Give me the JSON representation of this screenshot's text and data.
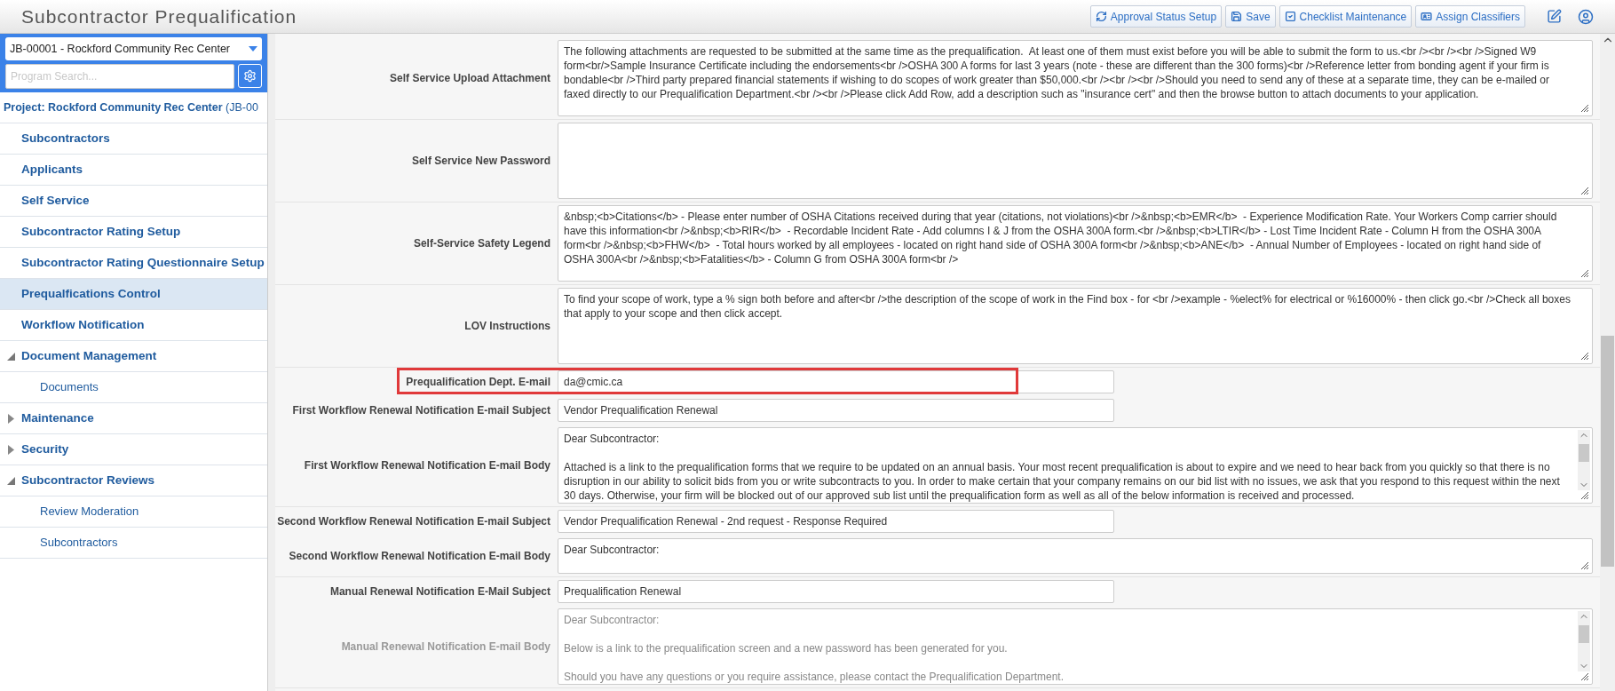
{
  "header": {
    "title": "Subcontractor Prequalification",
    "buttons": [
      {
        "kind": "refresh",
        "label": "Approval Status Setup"
      },
      {
        "kind": "save",
        "label": "Save"
      },
      {
        "kind": "check",
        "label": "Checklist Maintenance"
      },
      {
        "kind": "card",
        "label": "Assign Classifiers"
      }
    ]
  },
  "sidebar": {
    "project_select": "JB-00001 - Rockford Community Rec Center",
    "search": {
      "placeholder": "Program Search..."
    },
    "project": "**Project: Rockford Community Rec Center** (JB-00",
    "items": [
      {
        "label": "Subcontractors",
        "selected": false
      },
      {
        "label": "Applicants",
        "selected": false
      },
      {
        "label": "Self Service",
        "selected": false
      },
      {
        "label": "Subcontractor Rating Setup",
        "selected": false
      },
      {
        "label": "Subcontractor Rating Questionnaire Setup",
        "selected": false
      },
      {
        "label": "Prequalfications Control",
        "selected": true
      },
      {
        "label": "Workflow Notification",
        "selected": false
      },
      {
        "label": "Document Management",
        "selected": false,
        "expanded": true,
        "children": [
          {
            "label": "Documents",
            "selected": false
          }
        ]
      },
      {
        "label": "Maintenance",
        "selected": false,
        "expanded": false
      },
      {
        "label": "Security",
        "selected": false,
        "expanded": false
      },
      {
        "label": "Subcontractor Reviews",
        "selected": false,
        "expanded": true,
        "children": [
          {
            "label": "Review Moderation",
            "selected": false
          },
          {
            "label": "Subcontractors",
            "selected": false
          }
        ]
      }
    ]
  },
  "form": {
    "fields": [
      {
        "kind": "textarea",
        "label": "Self Service Upload Attachment",
        "value": "The following attachments are requested to be submitted at the same time as the prequalification.  At least one of them must exist before you will be able to submit the form to us.<br /><br /><br />Signed W9 form<br/>Sample Insurance Certificate including the endorsements<br />OSHA 300 A forms for last 3 years (note - these are different than the 300 forms)<br />Reference letter from bonding agent if your firm is bondable<br />Third party prepared financial statements if wishing to do scopes of work greater than $50,000.<br /><br /><br />Should you need to send any of these at a separate time, they can be e-mailed or faxed directly to our Prequalification Department.<br /><br />Please click Add Row, add a description such as \"insurance cert\" and then the browse button to attach documents to your application."
      },
      {
        "kind": "textarea",
        "label": "Self Service New Password"
      },
      {
        "kind": "textarea",
        "label": "Self-Service Safety Legend",
        "value": "&nbsp;<b>Citations</b> - Please enter number of OSHA Citations received during that year (citations, not violations)<br />&nbsp;<b>EMR</b>  - Experience Modification Rate. Your Workers Comp carrier should have this information<br />&nbsp;<b>RIR</b>  - Recordable Incident Rate - Add columns I & J from the OSHA 300A form.<br />&nbsp;<b>LTIR</b> - Lost Time Incident Rate - Column H from the OSHA 300A form<br />&nbsp;<b>FHW</b>  - Total hours worked by all employees - located on right hand side of OSHA 300A form<br />&nbsp;<b>ANE</b>  - Annual Number of Employees - located on right hand side of OSHA 300A<br />&nbsp;<b>Fatalities</b> - Column G from OSHA 300A form<br />"
      },
      {
        "kind": "textarea",
        "label": "LOV Instructions",
        "value": "To find your scope of work, type a % sign both before and after<br />the description of the scope of work in the Find box - for <br />example - %elect% for electrical or %16000% - then click go.<br />Check all boxes that apply to your scope and then click accept."
      },
      {
        "kind": "input",
        "label": "Prequalification Dept. E-mail",
        "value": "da@cmic.ca",
        "highlighted": true
      },
      {
        "kind": "input",
        "label": "First Workflow Renewal Notification E-mail Subject",
        "value": "Vendor Prequalification Renewal"
      },
      {
        "kind": "textarea",
        "scrollbar": true,
        "label": "First Workflow Renewal Notification E-mail Body",
        "value": "Dear Subcontractor:\n\nAttached is a link to the prequalification forms that we require to be updated on an annual basis. Your most recent prequalification is about to expire and we need to hear back from you quickly so that there is no disruption in our ability to solicit bids from you or write subcontracts to you. In order to make certain that your company remains on our bid list with no issues, we ask that you respond to this request within the next 30 days. Otherwise, your firm will be blocked out of our approved sub list until the prequalification form as well as all of the below information is received and processed."
      },
      {
        "kind": "input",
        "label": "Second Workflow Renewal Notification E-mail Subject",
        "value": "Vendor Prequalification Renewal - 2nd request - Response Required"
      },
      {
        "kind": "short_textarea",
        "label": "Second Workflow Renewal Notification E-mail Body",
        "value": "Dear Subcontractor:"
      },
      {
        "kind": "input",
        "label": "Manual Renewal Notification E-Mail Subject",
        "value": "Prequalification Renewal"
      },
      {
        "kind": "textarea",
        "scrollbar": true,
        "disabled": true,
        "label": "Manual Renewal Notification E-mail Body",
        "value": "Dear Subcontractor:\n\nBelow is a link to the prequalification screen and a new password has been generated for you.\n\nShould you have any questions or you require assistance, please contact the Prequalification Department."
      }
    ]
  }
}
